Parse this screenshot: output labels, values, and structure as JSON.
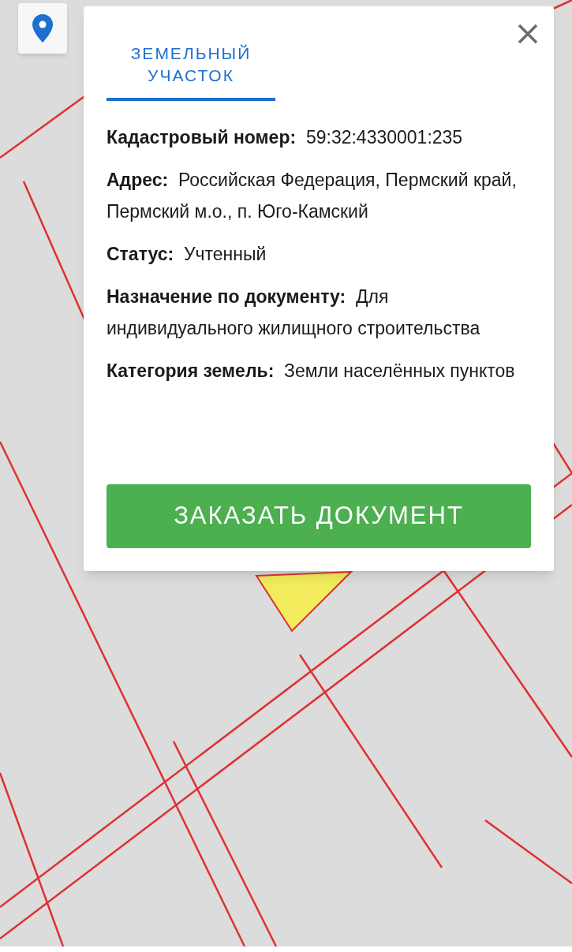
{
  "tabs": [
    {
      "label": "ЗЕМЕЛЬНЫЙ УЧАСТОК",
      "selected": true
    }
  ],
  "fields": [
    {
      "label": "Кадастровый номер:",
      "value": "59:32:4330001:235"
    },
    {
      "label": "Адрес:",
      "value": "Российская Федерация, Пермский край, Пермский м.о., п. Юго-Камский"
    },
    {
      "label": "Статус:",
      "value": "Учтенный"
    },
    {
      "label": "Назначение по документу:",
      "value": "Для индивидуального жилищного строительства"
    },
    {
      "label": "Категория земель:",
      "value": "Земли населённых пунктов"
    }
  ],
  "order_button": "ЗАКАЗАТЬ ДОКУМЕНТ"
}
